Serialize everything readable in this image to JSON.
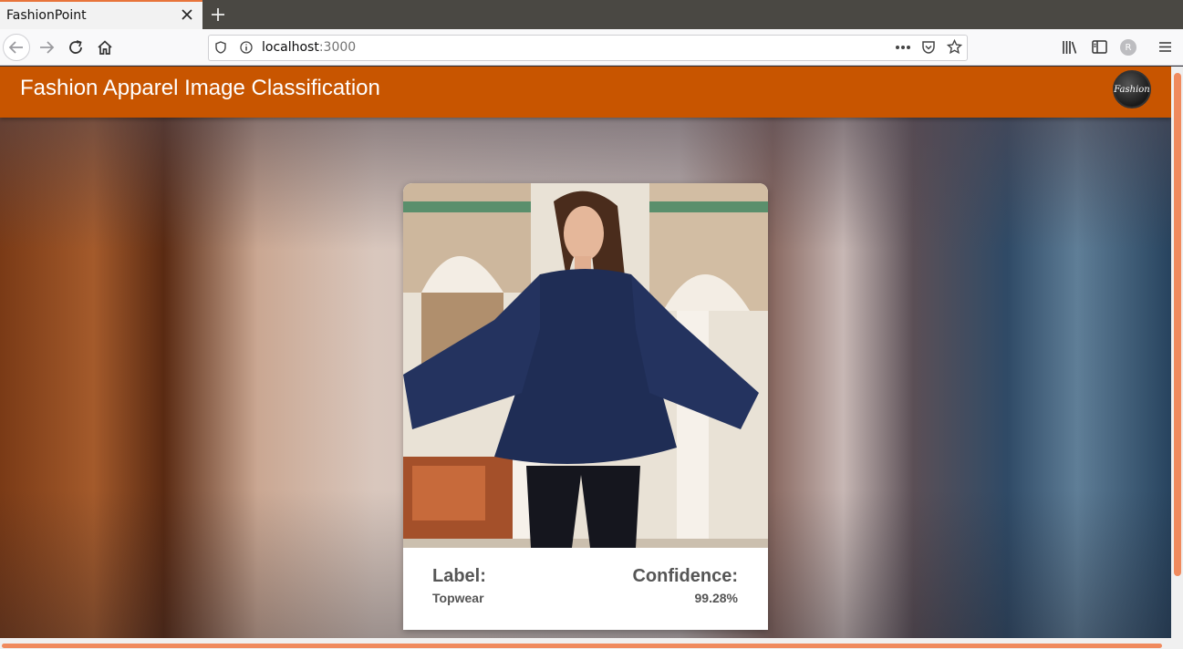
{
  "browser": {
    "tab_title": "FashionPoint",
    "url_host": "localhost",
    "url_port": ":3000",
    "profile_initial": "R"
  },
  "app": {
    "title": "Fashion Apparel Image Classification",
    "logo_text": "Fashion",
    "brand_color": "#c85500"
  },
  "result": {
    "label_heading": "Label:",
    "label_value": "Topwear",
    "confidence_heading": "Confidence:",
    "confidence_value": "99.28%"
  }
}
